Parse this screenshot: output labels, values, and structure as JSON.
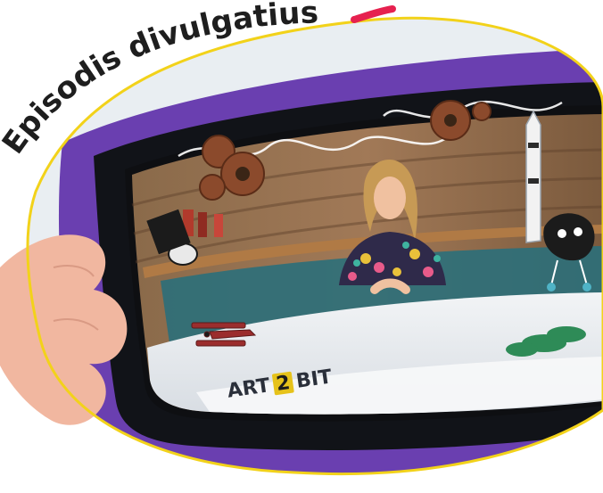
{
  "headline": {
    "text": "Episodis divulgatius",
    "accent_color": "#e6214f",
    "text_color": "#1e1e1e"
  },
  "logo": {
    "left": "ART",
    "middle": "2",
    "right": "BIT"
  },
  "colors": {
    "tablet_case": "#6a3fb0",
    "outline": "#f2d21a",
    "highlight_mark": "#e6214f"
  }
}
